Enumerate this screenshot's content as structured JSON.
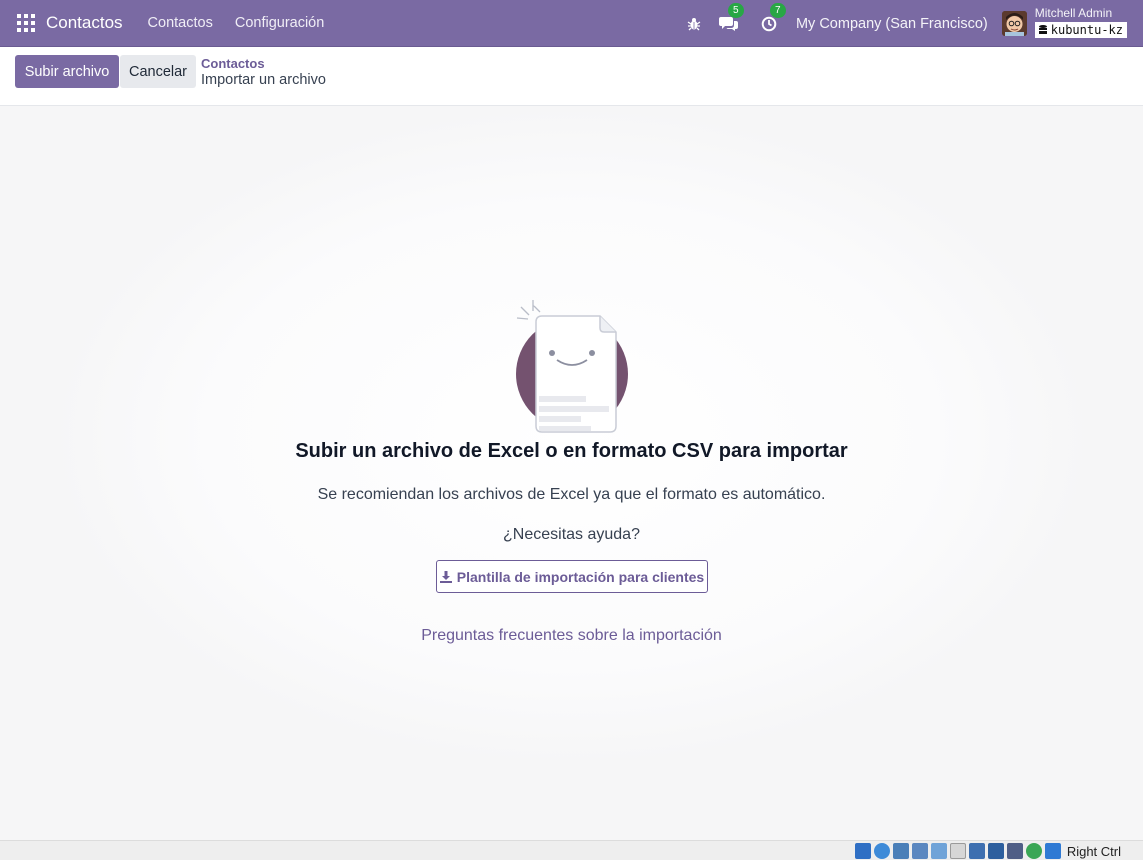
{
  "navbar": {
    "app_title": "Contactos",
    "menu": [
      "Contactos",
      "Configuración"
    ],
    "messages_count": "5",
    "activities_count": "7",
    "company": "My Company (San Francisco)",
    "user_name": "Mitchell Admin",
    "database": "kubuntu-kz"
  },
  "control_panel": {
    "upload_button": "Subir archivo",
    "cancel_button": "Cancelar",
    "breadcrumb_parent": "Contactos",
    "breadcrumb_current": "Importar un archivo"
  },
  "main": {
    "title": "Subir un archivo de Excel o en formato CSV para importar",
    "subtitle": "Se recomiendan los archivos de Excel ya que el formato es automático.",
    "help_text": "¿Necesitas ayuda?",
    "template_button": "Plantilla de importación para clientes",
    "faq_link": "Preguntas frecuentes sobre la importación"
  },
  "statusbar": {
    "host_key": "Right Ctrl"
  },
  "colors": {
    "brand": "#7a6aa3",
    "link": "#6c5c97",
    "badge": "#28a745"
  }
}
